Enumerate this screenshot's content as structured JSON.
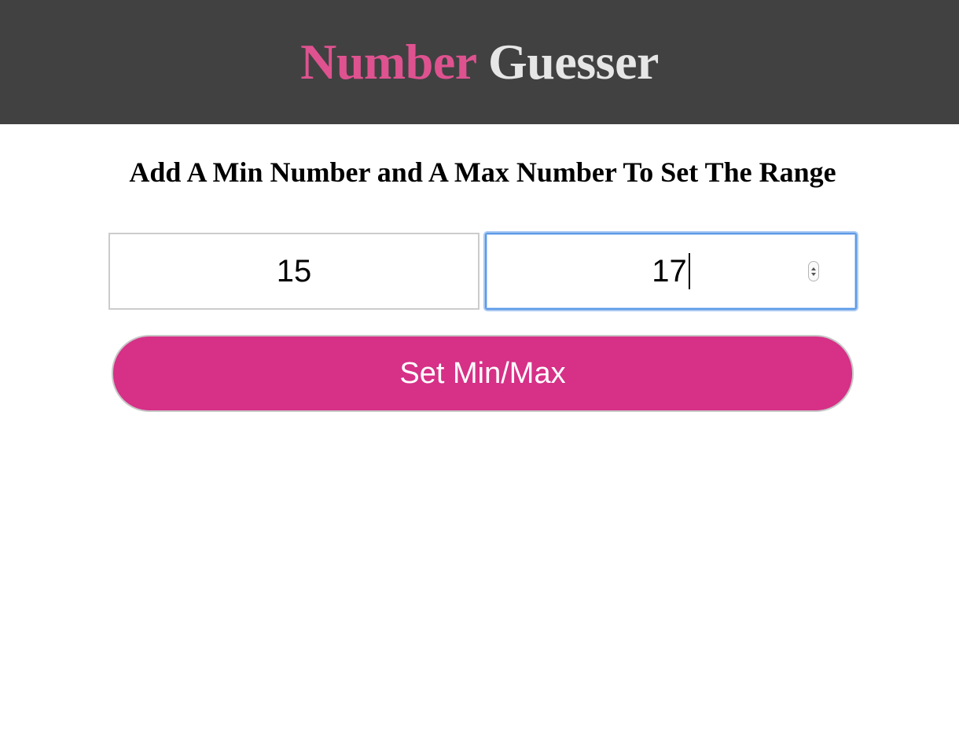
{
  "header": {
    "title_word_1": "Number",
    "title_word_2": "Guesser",
    "background": "#414141",
    "accent_color": "#df5290",
    "title_color": "#e6e6e6"
  },
  "main": {
    "instruction": "Add A Min Number and A Max Number To Set The Range",
    "min_input": {
      "value": "15"
    },
    "max_input": {
      "value": "17",
      "focused": true
    },
    "submit_label": "Set Min/Max",
    "button_color": "#d63087"
  }
}
